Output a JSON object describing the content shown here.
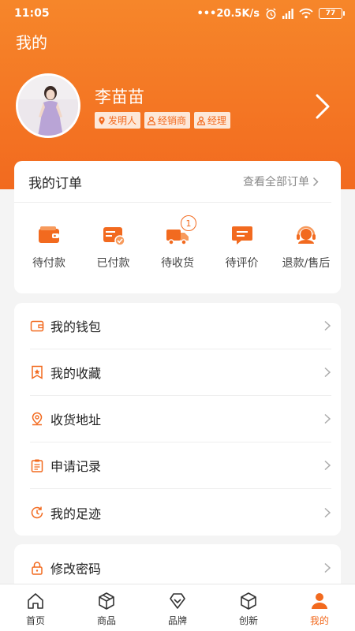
{
  "status_bar": {
    "time": "11:05",
    "network_speed": "•••20.5K/s",
    "battery": "77"
  },
  "header": {
    "title": "我的"
  },
  "profile": {
    "name": "李苗苗",
    "tags": [
      "发明人",
      "经销商",
      "经理"
    ]
  },
  "orders": {
    "title": "我的订单",
    "view_all": "查看全部订单",
    "items": [
      {
        "label": "待付款",
        "icon": "wallet-icon"
      },
      {
        "label": "已付款",
        "icon": "paid-card-icon"
      },
      {
        "label": "待收货",
        "icon": "truck-icon",
        "badge": "1"
      },
      {
        "label": "待评价",
        "icon": "comment-icon"
      },
      {
        "label": "退款/售后",
        "icon": "customer-service-icon"
      }
    ]
  },
  "menu": {
    "items": [
      {
        "label": "我的钱包",
        "icon": "wallet-outline-icon"
      },
      {
        "label": "我的收藏",
        "icon": "star-bookmark-icon"
      },
      {
        "label": "收货地址",
        "icon": "location-icon"
      },
      {
        "label": "申请记录",
        "icon": "clipboard-icon"
      },
      {
        "label": "我的足迹",
        "icon": "history-icon"
      }
    ],
    "security": {
      "label": "修改密码",
      "icon": "lock-icon"
    }
  },
  "tab_bar": {
    "items": [
      {
        "label": "首页",
        "icon": "home-icon"
      },
      {
        "label": "商品",
        "icon": "box-icon"
      },
      {
        "label": "品牌",
        "icon": "diamond-icon"
      },
      {
        "label": "创新",
        "icon": "cube-icon"
      },
      {
        "label": "我的",
        "icon": "user-icon"
      }
    ],
    "active_index": 4
  },
  "colors": {
    "accent": "#f26a1f",
    "accent_light": "#f6862a",
    "background": "#f4f4f4"
  }
}
